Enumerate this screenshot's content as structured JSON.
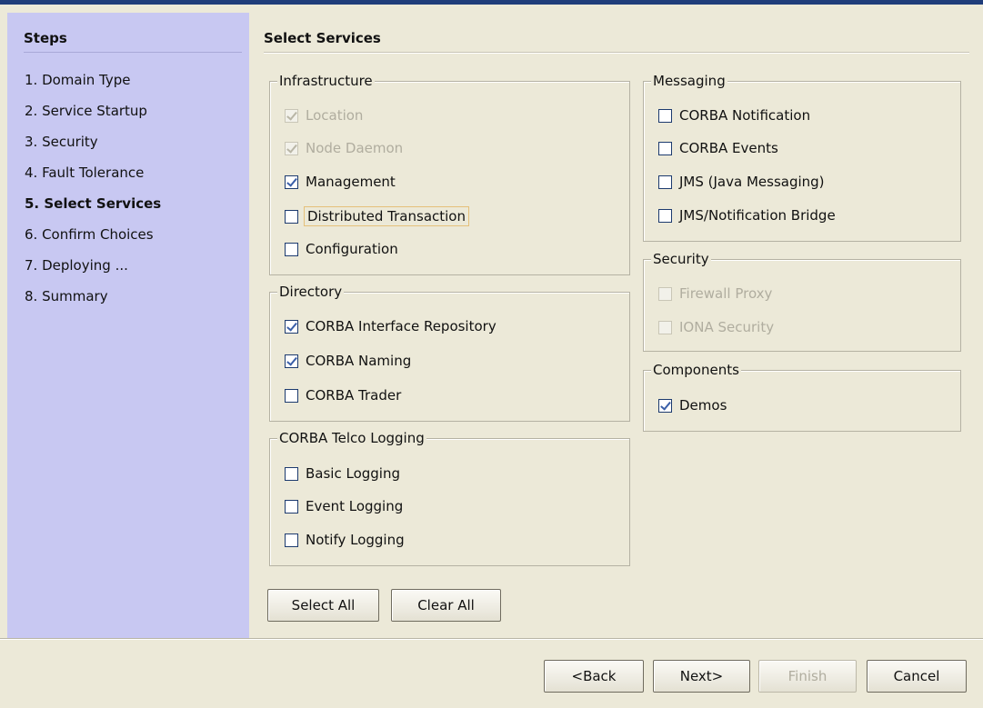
{
  "sidebar": {
    "title": "Steps",
    "steps": [
      {
        "label": "1. Domain Type"
      },
      {
        "label": "2. Service Startup"
      },
      {
        "label": "3. Security"
      },
      {
        "label": "4. Fault Tolerance"
      },
      {
        "label": "5. Select Services"
      },
      {
        "label": "6. Confirm Choices"
      },
      {
        "label": "7. Deploying ..."
      },
      {
        "label": "8. Summary"
      }
    ],
    "current_step": 5
  },
  "main": {
    "title": "Select Services",
    "groups": {
      "infrastructure": {
        "legend": "Infrastructure",
        "items": [
          {
            "label": "Location",
            "checked": true,
            "enabled": false
          },
          {
            "label": "Node Daemon",
            "checked": true,
            "enabled": false
          },
          {
            "label": "Management",
            "checked": true,
            "enabled": true
          },
          {
            "label": "Distributed Transaction",
            "checked": false,
            "enabled": true,
            "focused": true
          },
          {
            "label": "Configuration",
            "checked": false,
            "enabled": true
          }
        ]
      },
      "directory": {
        "legend": "Directory",
        "items": [
          {
            "label": "CORBA Interface Repository",
            "checked": true,
            "enabled": true
          },
          {
            "label": "CORBA Naming",
            "checked": true,
            "enabled": true
          },
          {
            "label": "CORBA Trader",
            "checked": false,
            "enabled": true
          }
        ]
      },
      "telco_logging": {
        "legend": "CORBA Telco Logging",
        "items": [
          {
            "label": "Basic Logging",
            "checked": false,
            "enabled": true
          },
          {
            "label": "Event Logging",
            "checked": false,
            "enabled": true
          },
          {
            "label": "Notify Logging",
            "checked": false,
            "enabled": true
          }
        ]
      },
      "messaging": {
        "legend": "Messaging",
        "items": [
          {
            "label": "CORBA Notification",
            "checked": false,
            "enabled": true
          },
          {
            "label": "CORBA Events",
            "checked": false,
            "enabled": true
          },
          {
            "label": "JMS (Java Messaging)",
            "checked": false,
            "enabled": true
          },
          {
            "label": "JMS/Notification Bridge",
            "checked": false,
            "enabled": true
          }
        ]
      },
      "security": {
        "legend": "Security",
        "items": [
          {
            "label": "Firewall Proxy",
            "checked": false,
            "enabled": false
          },
          {
            "label": "IONA Security",
            "checked": false,
            "enabled": false
          }
        ]
      },
      "components": {
        "legend": "Components",
        "items": [
          {
            "label": "Demos",
            "checked": true,
            "enabled": true
          }
        ]
      }
    },
    "select_all_label": "Select All",
    "clear_all_label": "Clear All"
  },
  "footer": {
    "back_label": "<Back",
    "next_label": "Next>",
    "finish_label": "Finish",
    "cancel_label": "Cancel",
    "finish_enabled": false
  },
  "colors": {
    "sidebar_bg": "#c8c8f2",
    "window_bg": "#ece9d8",
    "check_mark": "#3a5fa8"
  }
}
